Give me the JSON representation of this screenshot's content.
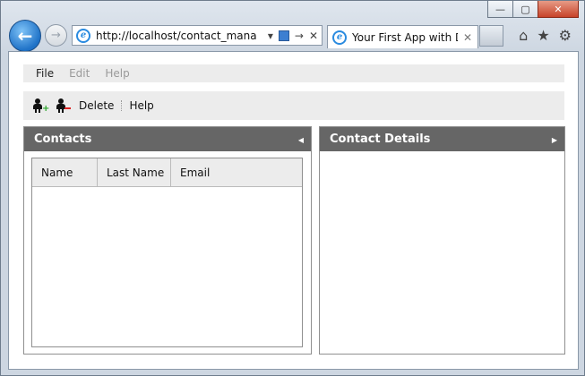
{
  "browser": {
    "url": "http://localhost/contact_manag",
    "tab_title": "Your First App with D...",
    "back_glyph": "←",
    "forward_glyph": "→",
    "tab_close_glyph": "✕",
    "addr_dropdown_glyph": "▾",
    "addr_go_glyph": "→",
    "addr_stop_glyph": "✕",
    "home_glyph": "⌂",
    "favorites_glyph": "★",
    "tools_glyph": "⚙",
    "window_minimize_glyph": "—",
    "window_maximize_glyph": "▢",
    "window_close_glyph": "✕"
  },
  "menu": {
    "items": [
      {
        "label": "File",
        "enabled": true
      },
      {
        "label": "Edit",
        "enabled": false
      },
      {
        "label": "Help",
        "enabled": false
      }
    ]
  },
  "toolbar": {
    "add_icon": "add-contact-icon",
    "delete_icon": "delete-contact-icon",
    "delete_label": "Delete",
    "help_label": "Help"
  },
  "contacts_panel": {
    "title": "Contacts",
    "columns": [
      "Name",
      "Last Name",
      "Email"
    ],
    "rows": []
  },
  "details_panel": {
    "title": "Contact Details"
  },
  "colors": {
    "panel_header": "#666666",
    "bar_background": "#ececec"
  }
}
